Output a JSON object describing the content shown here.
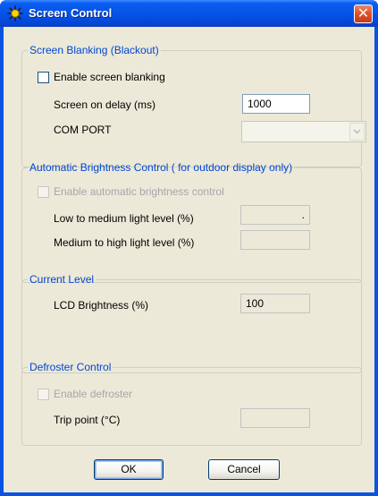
{
  "window": {
    "title": "Screen Control",
    "close_symbol": "✕"
  },
  "screen_blanking": {
    "legend": "Screen Blanking (Blackout)",
    "enable_label": "Enable screen blanking",
    "enabled": false,
    "delay_label": "Screen on delay (ms)",
    "delay_value": "1000",
    "com_port_label": "COM PORT",
    "com_port_value": ""
  },
  "auto_brightness": {
    "legend": "Automatic Brightness Control ( for outdoor display only)",
    "enable_label": "Enable automatic brightness control",
    "enabled": false,
    "low_medium_label": "Low to medium light level (%)",
    "low_medium_value": ".",
    "medium_high_label": "Medium to high light level (%)",
    "medium_high_value": ""
  },
  "current_level": {
    "legend": "Current Level",
    "lcd_label": "LCD Brightness (%)",
    "lcd_value": "100"
  },
  "defroster": {
    "legend": "Defroster Control",
    "enable_label": "Enable defroster",
    "enabled": false,
    "trip_label": "Trip point (°C)",
    "trip_value": ""
  },
  "buttons": {
    "ok": "OK",
    "cancel": "Cancel"
  },
  "icons": {
    "title": "sun-icon",
    "close": "close-icon",
    "dropdown": "chevron-down-icon"
  },
  "colors": {
    "titlebar": "#0653e8",
    "group_legend": "#0046d5",
    "dialog_face": "#ece9d8",
    "close_button": "#e2532a"
  }
}
